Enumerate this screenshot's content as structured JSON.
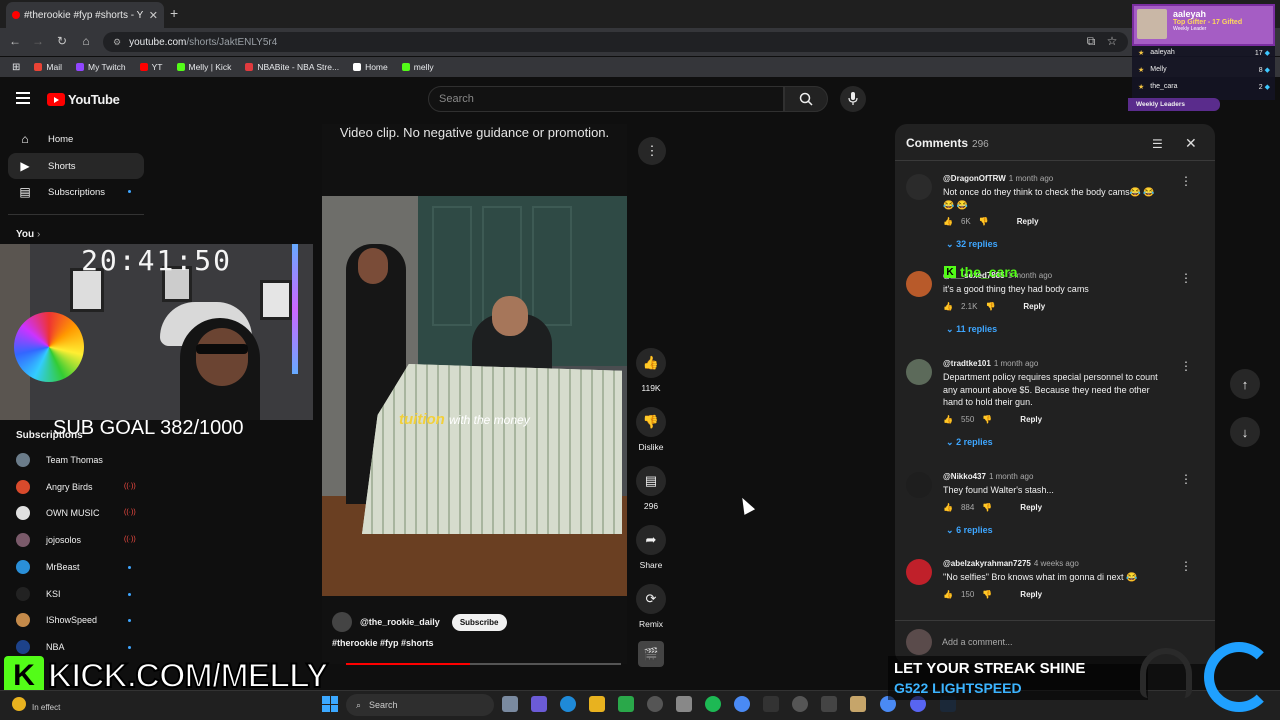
{
  "browser": {
    "tab_title": "#therookie #fyp #shorts - Y",
    "url_host": "youtube.com",
    "url_path": "/shorts/JaktENLY5r4",
    "bookmarks": [
      {
        "label": "Mail",
        "color": "#ea4335"
      },
      {
        "label": "My Twitch",
        "color": "#9146ff"
      },
      {
        "label": "YT",
        "color": "#ff0000"
      },
      {
        "label": "Melly | Kick",
        "color": "#53fc18"
      },
      {
        "label": "NBABite - NBA Stre...",
        "color": "#e03a3e"
      },
      {
        "label": "Home",
        "color": "#ffffff"
      },
      {
        "label": "melly",
        "color": "#53fc18"
      }
    ]
  },
  "youtube": {
    "logo": "YouTube",
    "search_placeholder": "Search",
    "nav": [
      {
        "label": "Home",
        "icon": "home-icon"
      },
      {
        "label": "Shorts",
        "icon": "shorts-icon"
      },
      {
        "label": "Subscriptions",
        "icon": "subscriptions-icon"
      }
    ],
    "you_label": "You",
    "subscriptions_label": "Subscriptions",
    "subscriptions": [
      {
        "name": "Team Thomas",
        "color": "#6b7c8a",
        "status": ""
      },
      {
        "name": "Angry Birds",
        "color": "#d84a2c",
        "status": "live"
      },
      {
        "name": "OWN MUSIC",
        "color": "#e0e0e0",
        "status": "live"
      },
      {
        "name": "jojosolos",
        "color": "#7a5a6a",
        "status": "live"
      },
      {
        "name": "MrBeast",
        "color": "#2a8fd8",
        "status": "dot"
      },
      {
        "name": "KSI",
        "color": "#222222",
        "status": "dot"
      },
      {
        "name": "IShowSpeed",
        "color": "#c48a4a",
        "status": "dot"
      },
      {
        "name": "NBA",
        "color": "#1d428a",
        "status": "dot"
      }
    ]
  },
  "stream": {
    "clock": "20:41:50",
    "sub_goal": "SUB GOAL 382/1000",
    "kick_banner": "KICK.COM/MELLY",
    "chat_name": "the_cara",
    "gifter": {
      "name": "aaleyah",
      "line": "Top Gifter - 17 Gifted",
      "sub": "Weekly Leader"
    },
    "leaders": [
      {
        "name": "aaleyah",
        "value": "17"
      },
      {
        "name": "Melly",
        "value": "8"
      },
      {
        "name": "the_cara",
        "value": "2"
      }
    ],
    "leaders_label": "Weekly Leaders",
    "ad_line1": "LET YOUR STREAK SHINE",
    "ad_line2": "G522 LIGHTSPEED"
  },
  "short": {
    "caption": "Video clip. No negative guidance or promotion.",
    "overlay_strong": "tuition",
    "overlay_rest": "with the money",
    "channel": "@the_rookie_daily",
    "subscribe": "Subscribe",
    "tags": "#therookie #fyp #shorts",
    "progress": 0.45,
    "actions": {
      "likes": "119K",
      "dislike": "Dislike",
      "comments": "296",
      "share": "Share",
      "remix": "Remix"
    }
  },
  "comments": {
    "title": "Comments",
    "count": "296",
    "add_placeholder": "Add a comment...",
    "reply_label": "Reply",
    "items": [
      {
        "user": "@DragonOfTRW",
        "time": "1 month ago",
        "text": "Not once do they think to check the body cams😂 😂 😂 😂",
        "likes": "6K",
        "replies": "32 replies",
        "color": "#2b2b2b"
      },
      {
        "user": "@___sexed7885",
        "time": "1 month ago",
        "text": "it's a good thing they had body cams",
        "likes": "2.1K",
        "replies": "11 replies",
        "color": "#b85a2a"
      },
      {
        "user": "@tradtke101",
        "time": "1 month ago",
        "text": "Department policy requires special personnel to count any amount above $5. Because they need the other hand to hold their gun.",
        "likes": "550",
        "replies": "2 replies",
        "color": "#5c6a5a"
      },
      {
        "user": "@Nikko437",
        "time": "1 month ago",
        "text": "They found Walter's stash...",
        "likes": "884",
        "replies": "6 replies",
        "color": "#1e1e1e"
      },
      {
        "user": "@abelzakyrahman7275",
        "time": "4 weeks ago",
        "text": "\"No selfies\" Bro knows what im gonna di next 😂",
        "likes": "150",
        "replies": "",
        "color": "#c0202a"
      }
    ]
  },
  "taskbar": {
    "search_placeholder": "Search",
    "effect_text": "In effect"
  }
}
